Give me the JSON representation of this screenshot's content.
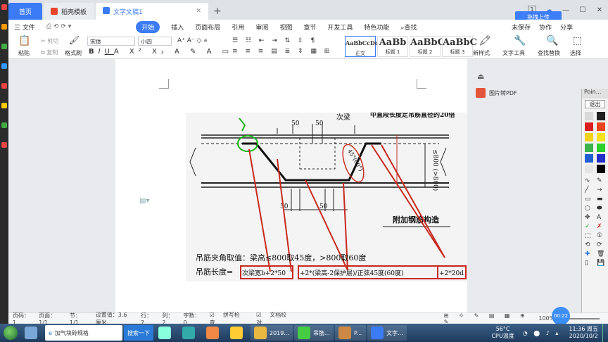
{
  "tabs": {
    "home": "首页",
    "template": "稻壳模板",
    "document": "文字文稿1"
  },
  "window": {
    "upload_label": "拖拽上传",
    "page_num": "1"
  },
  "menu": {
    "items": [
      "三 文件",
      "开始",
      "插入",
      "页面布局",
      "引用",
      "审阅",
      "视图",
      "章节",
      "开发工具",
      "特色功能"
    ],
    "search": "查找",
    "right": [
      "未保存",
      "协作",
      "分享"
    ]
  },
  "ribbon": {
    "paste": "粘贴",
    "cut": "剪切",
    "copy": "复制",
    "format_painter": "格式刷",
    "font_name": "宋体",
    "font_size": "小四",
    "styles": [
      {
        "sample": "AaBbCcDd",
        "name": "正文"
      },
      {
        "sample": "AaBb",
        "name": "标题 1"
      },
      {
        "sample": "AaBbC",
        "name": "标题 2"
      },
      {
        "sample": "AaBbC",
        "name": "标题 3"
      }
    ],
    "new_style": "新样式",
    "text_tool": "文字工具",
    "find_replace": "查找替换",
    "select": "选择"
  },
  "side_panel": {
    "pdf_label": "图片转PDF"
  },
  "figure": {
    "title_top": "次梁",
    "note_top": "中直段长度定吊筋直径的20倍",
    "dim_50a": "50",
    "dim_50b": "50",
    "dim_50c": "50",
    "dim_50d": "50",
    "angle_label": "45°(60°)",
    "side_label": "≤800 (>800)",
    "caption": "附加钢筋构造",
    "line1": "吊筋夹角取值：梁高≤800取45度，>800取60度",
    "line2_prefix": "吊筋长度=",
    "box1": "次梁宽b+2*50",
    "box2": "+2*(梁高-2保护层)/正弦45度(60度)",
    "box3": "+2*20d"
  },
  "palette": {
    "title": "Poin...",
    "exit": "退出",
    "colors": [
      "#d8d8d8",
      "#202020",
      "#d81e1e",
      "#e8451e",
      "#f2d21b",
      "#f6e31b",
      "#3cb44b",
      "#2bd02b",
      "#1f5fd1",
      "#2030c8",
      "#e6e6e6",
      "#000000"
    ]
  },
  "status": {
    "page": "页码：1",
    "pages": "页面：1/1",
    "section": "节：1/1",
    "setting": "设置值：3.6厘米",
    "row": "行：2",
    "col": "列：2",
    "words": "字数：0",
    "spell": "拼写检查",
    "proof": "文档校对",
    "zoom": "100%",
    "timer": "00:22"
  },
  "taskbar": {
    "search_app": "加气块砖规格",
    "search_btn": "搜索一下",
    "items": [
      "2019...",
      "吊筋...",
      "P...",
      "文字..."
    ],
    "cpu": "56°C",
    "cpu_label": "CPU温度",
    "time": "11:36 周五",
    "date": "2020/10/2"
  }
}
